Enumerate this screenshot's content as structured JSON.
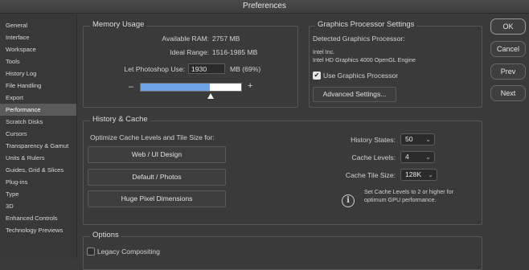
{
  "window": {
    "title": "Preferences"
  },
  "sidebar": {
    "items": [
      {
        "label": "General"
      },
      {
        "label": "Interface"
      },
      {
        "label": "Workspace"
      },
      {
        "label": "Tools"
      },
      {
        "label": "History Log"
      },
      {
        "label": "File Handling"
      },
      {
        "label": "Export"
      },
      {
        "label": "Performance",
        "selected": true
      },
      {
        "label": "Scratch Disks"
      },
      {
        "label": "Cursors"
      },
      {
        "label": "Transparency & Gamut"
      },
      {
        "label": "Units & Rulers"
      },
      {
        "label": "Guides, Grid & Slices"
      },
      {
        "label": "Plug-ins"
      },
      {
        "label": "Type"
      },
      {
        "label": "3D"
      },
      {
        "label": "Enhanced Controls"
      },
      {
        "label": "Technology Previews"
      }
    ]
  },
  "memory": {
    "title": "Memory Usage",
    "available_label": "Available RAM:",
    "available_value": "2757 MB",
    "ideal_label": "Ideal Range:",
    "ideal_value": "1516-1985 MB",
    "let_use_label": "Let Photoshop Use:",
    "let_use_value": "1930",
    "let_use_suffix": "MB (69%)",
    "minus": "–",
    "plus": "+",
    "slider_fraction": 0.69
  },
  "gpu": {
    "title": "Graphics Processor Settings",
    "detected_label": "Detected Graphics Processor:",
    "vendor": "Intel Inc.",
    "model": "Intel HD Graphics 4000 OpenGL Engine",
    "use_label": "Use Graphics Processor",
    "use_checked": true,
    "advanced_button": "Advanced Settings..."
  },
  "history_cache": {
    "title": "History & Cache",
    "optimize_label": "Optimize Cache Levels and Tile Size for:",
    "buttons": [
      "Web / UI Design",
      "Default / Photos",
      "Huge Pixel Dimensions"
    ],
    "history_states_label": "History States:",
    "history_states_value": "50",
    "cache_levels_label": "Cache Levels:",
    "cache_levels_value": "4",
    "cache_tile_label": "Cache Tile Size:",
    "cache_tile_value": "128K",
    "info_line1": "Set Cache Levels to 2 or higher for",
    "info_line2": "optimum GPU performance."
  },
  "options": {
    "title": "Options",
    "legacy_label": "Legacy Compositing",
    "legacy_checked": false
  },
  "actions": {
    "ok": "OK",
    "cancel": "Cancel",
    "prev": "Prev",
    "next": "Next"
  },
  "icons": {
    "info": "info-icon",
    "chevron": "chevron-updown-icon",
    "check": "checkmark-icon"
  }
}
